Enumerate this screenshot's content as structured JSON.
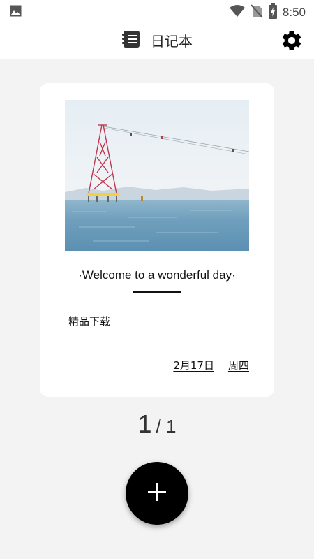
{
  "status_bar": {
    "time": "8:50",
    "icons": [
      "image-icon",
      "wifi-icon",
      "no-sim-icon",
      "battery-charging-icon"
    ]
  },
  "app_bar": {
    "title": "日记本",
    "icons": [
      "notebook-icon",
      "gear-icon"
    ]
  },
  "diary_card": {
    "image_subject": "sea-tower-cable-car-photo",
    "welcome_text": "·Welcome to a wonderful day·",
    "entry_text": "精品下载",
    "date": "2月17日",
    "weekday": "周四"
  },
  "pager": {
    "current": "1",
    "separator_total": "/ 1"
  },
  "fab": {
    "icon": "plus-icon"
  },
  "colors": {
    "background": "#f3f3f3",
    "card": "#ffffff",
    "fab": "#000000",
    "text": "#111111"
  }
}
